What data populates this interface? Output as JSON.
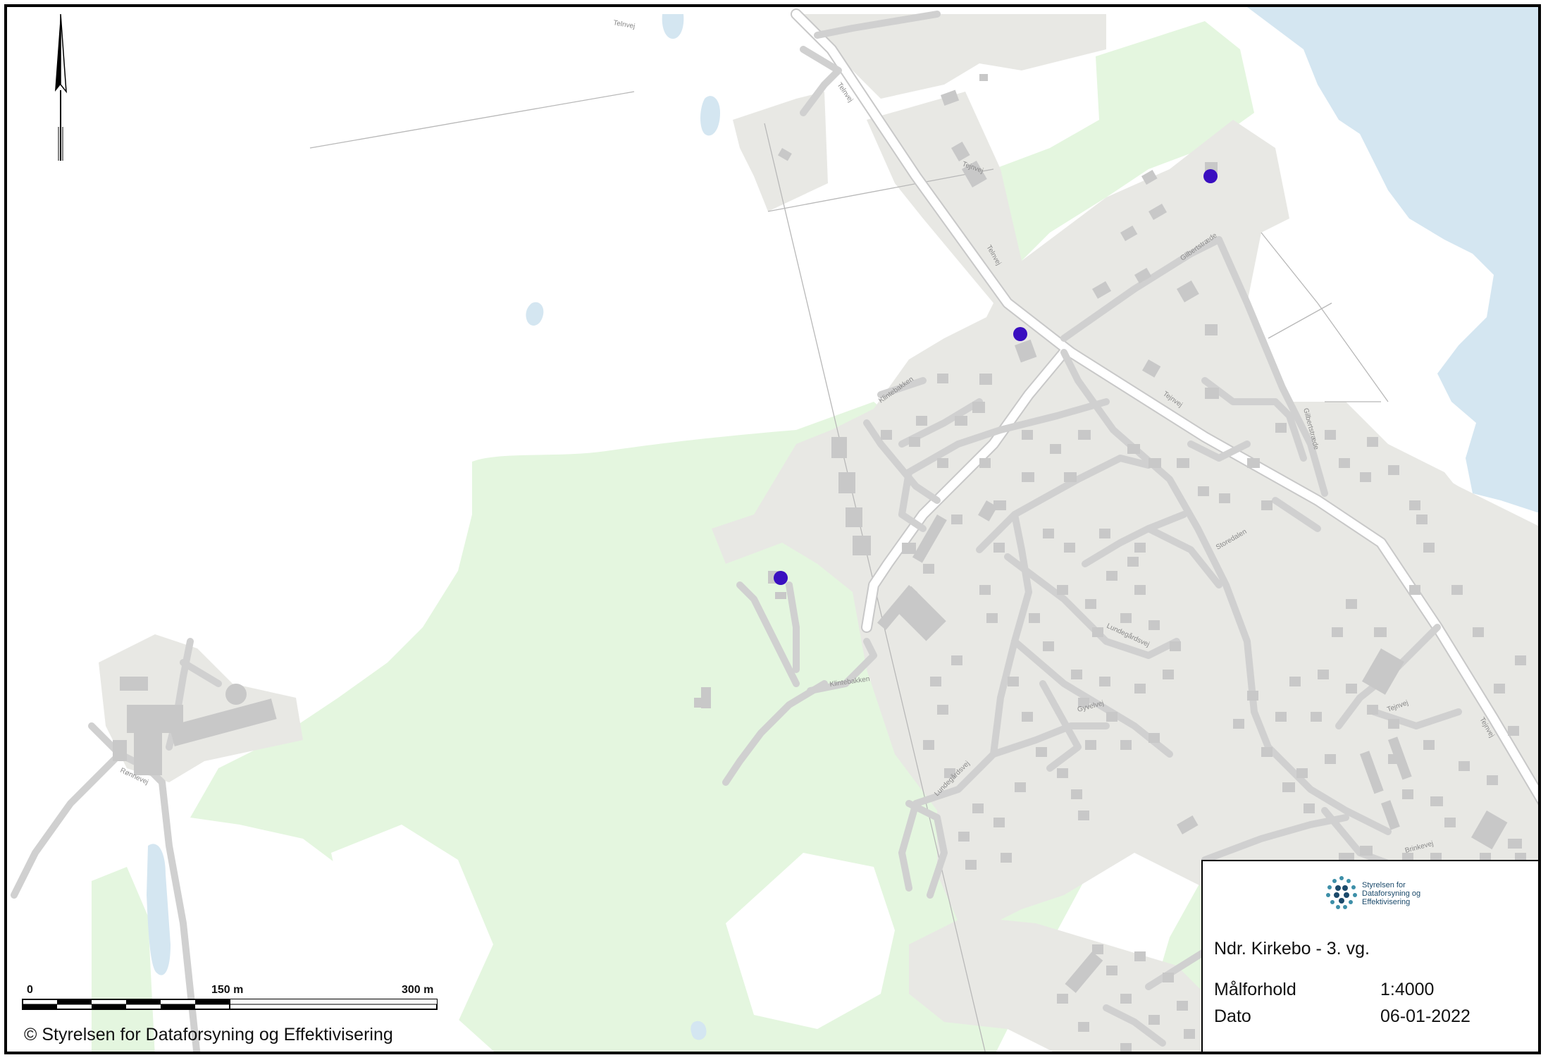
{
  "map": {
    "scale_bar": {
      "labels": [
        "0",
        "150 m",
        "300 m"
      ]
    },
    "road_labels": [
      "Telnvej",
      "Telnvej",
      "Telnvej",
      "Tejnvej",
      "Gilbertstræde",
      "Klintebakken",
      "Klintebakken",
      "Lundegårdsvej",
      "Lundegårdsvej",
      "Gyvelvej",
      "Storedalen",
      "Tejnvej",
      "Brinkevej",
      "Tejnvej",
      "Rønnevej",
      "Gilbertstræde",
      "Tejnvej"
    ],
    "markers": [
      {
        "name": "marker-1"
      },
      {
        "name": "marker-2"
      },
      {
        "name": "marker-3"
      }
    ],
    "colors": {
      "marker": "#3a0fc0",
      "residential": "#e8e8e4",
      "forest": "#e4f6df",
      "water": "#d4e6f1",
      "building": "#c4c4c4",
      "road": "#ffffff"
    },
    "north_arrow_icon": "north-arrow-icon"
  },
  "legend": {
    "logo_text": "Styrelsen for Dataforsyning og Effektivisering",
    "title": "Ndr. Kirkebo - 3. vg.",
    "rows": [
      {
        "label": "Målforhold",
        "value": "1:4000"
      },
      {
        "label": "Dato",
        "value": "06-01-2022"
      }
    ]
  },
  "copyright": "© Styrelsen for Dataforsyning og Effektivisering"
}
